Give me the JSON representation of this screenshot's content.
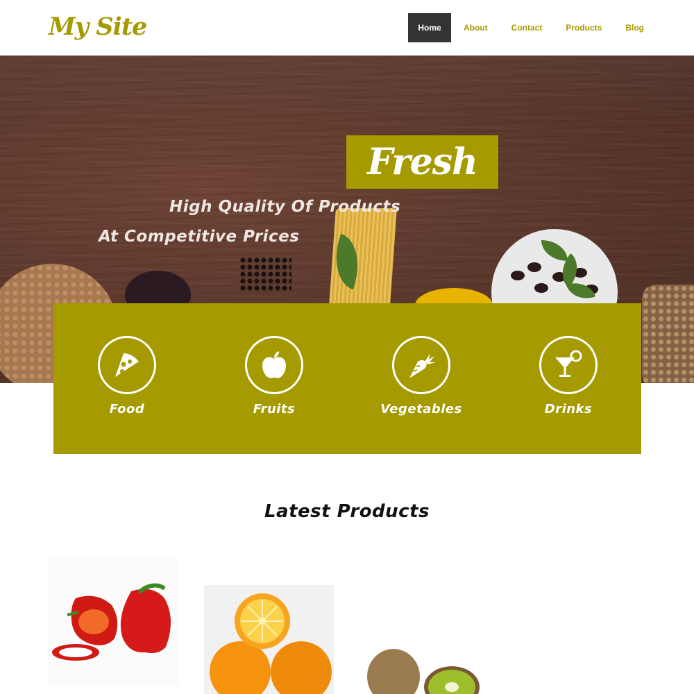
{
  "site": {
    "logo": "My Site"
  },
  "nav": {
    "items": [
      "Home",
      "About",
      "Contact",
      "Products",
      "Blog"
    ],
    "active": "Home"
  },
  "hero": {
    "badge": "Fresh",
    "line1": "High Quality Of Products",
    "line2": "At Competitive Prices"
  },
  "categories": [
    {
      "label": "Food",
      "icon": "pizza-icon"
    },
    {
      "label": "Fruits",
      "icon": "apple-icon"
    },
    {
      "label": "Vegetables",
      "icon": "carrot-icon"
    },
    {
      "label": "Drinks",
      "icon": "cocktail-icon"
    }
  ],
  "products": {
    "title": "Latest Products",
    "items": [
      {
        "image": "red-peppers"
      },
      {
        "image": "oranges"
      },
      {
        "image": "kiwi"
      }
    ]
  },
  "colors": {
    "accent": "#a59a00",
    "nav_active_bg": "#333333",
    "hero_wood": "#5a372c",
    "text_light": "#ffffff",
    "heading_dark": "#111111"
  }
}
